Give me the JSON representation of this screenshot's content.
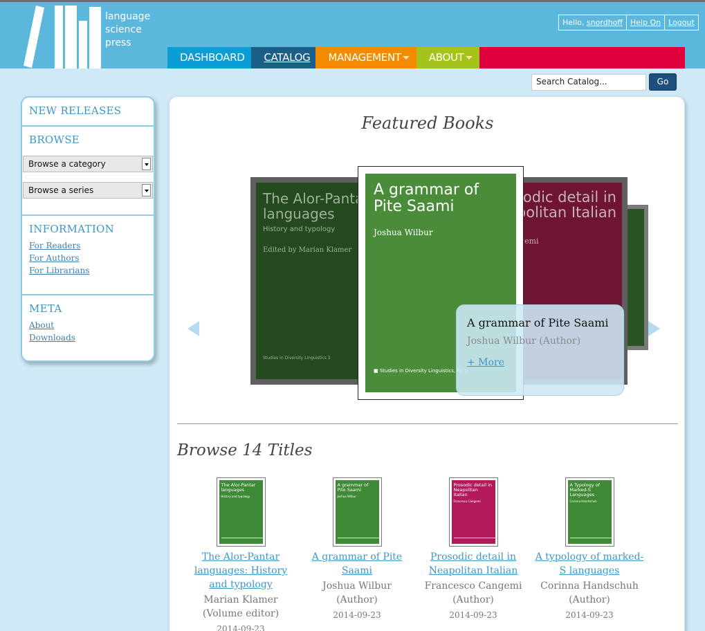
{
  "header": {
    "logo_lines": [
      "language",
      "science",
      "press"
    ],
    "user": {
      "greeting": "Hello,",
      "username": "snordhoff",
      "help": "Help On",
      "logout": "Logout"
    },
    "nav": [
      {
        "label": "DASHBOARD",
        "color": "#0c9dd4"
      },
      {
        "label": "CATALOG",
        "color": "#1b5e88"
      },
      {
        "label": "MANAGEMENT",
        "color": "#f38b00"
      },
      {
        "label": "ABOUT",
        "color": "#a5c41b"
      },
      {
        "label": "",
        "color": "#e1003e"
      }
    ]
  },
  "search": {
    "placeholder": "Search Catalog...",
    "value": "Search Catalog...",
    "button": "Go"
  },
  "sidebar": {
    "new_releases": "NEW RELEASES",
    "browse": "BROWSE",
    "category_select": "Browse a category",
    "series_select": "Browse a series",
    "information": "INFORMATION",
    "info_links": [
      "For Readers",
      "For Authors",
      "For Librarians"
    ],
    "meta": "META",
    "meta_links": [
      "About",
      "Downloads"
    ]
  },
  "featured": {
    "title": "Featured Books",
    "left_book": {
      "title": "The Alor-Pantar languages",
      "subtitle": "History and typology",
      "editor": "Edited by Marian Klamer",
      "series": "Studies in Diversity Linguistics 3"
    },
    "center_book": {
      "title": "A grammar of Pite Saami",
      "author": "Joshua Wilbur",
      "series": "Studies in Diversity Linguistics, No 5"
    },
    "right_book": {
      "title": "Prosodic detail in Neapolitan Italian",
      "author": "Cangemi"
    },
    "tooltip": {
      "title": "A grammar of Pite Saami",
      "author": "Joshua Wilbur (Author)",
      "more": "+ More"
    }
  },
  "browse": {
    "title": "Browse 14 Titles",
    "items": [
      {
        "thumb_title": "The Alor-Pantar languages",
        "thumb_sub": "History and typology",
        "thumb_color": "#3f8a36",
        "link": "The Alor-Pantar languages: History and typology",
        "author": "Marian Klamer (Volume editor)",
        "date": "2014-09-23"
      },
      {
        "thumb_title": "A grammar of Pite Saami",
        "thumb_sub": "Joshua Wilbur",
        "thumb_color": "#3f8a36",
        "link": "A grammar of Pite Saami",
        "author": "Joshua Wilbur (Author)",
        "date": "2014-09-23"
      },
      {
        "thumb_title": "Prosodic detail in Neapolitan Italian",
        "thumb_sub": "Francesco Cangemi",
        "thumb_color": "#b21a5b",
        "link": "Prosodic detail in Neapolitan Italian",
        "author": "Francesco Cangemi (Author)",
        "date": "2014-09-23"
      },
      {
        "thumb_title": "A Typology of Marked-S Languages",
        "thumb_sub": "Corinna Handschuh",
        "thumb_color": "#3f8a36",
        "link": "A typology of marked-S languages",
        "author": "Corinna Handschuh (Author)",
        "date": "2014-09-23"
      }
    ]
  }
}
